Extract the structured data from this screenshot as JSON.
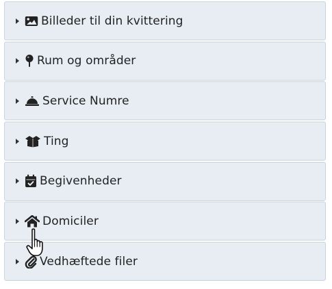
{
  "accordion": {
    "items": [
      {
        "label": "Billeder til din kvittering",
        "icon": "image-icon"
      },
      {
        "label": "Rum og områder",
        "icon": "map-pin-icon"
      },
      {
        "label": "Service Numre",
        "icon": "service-bell-icon"
      },
      {
        "label": "Ting",
        "icon": "open-box-icon"
      },
      {
        "label": "Begivenheder",
        "icon": "calendar-check-icon"
      },
      {
        "label": "Domiciler",
        "icon": "house-icon"
      },
      {
        "label": "Vedhæftede filer",
        "icon": "paperclip-icon"
      }
    ]
  },
  "colors": {
    "panel_bg": "#e7edf3",
    "panel_border": "#c8d3de",
    "text": "#222222",
    "icon": "#222222"
  },
  "cursor": {
    "icon": "hand-pointer-cursor-icon"
  }
}
